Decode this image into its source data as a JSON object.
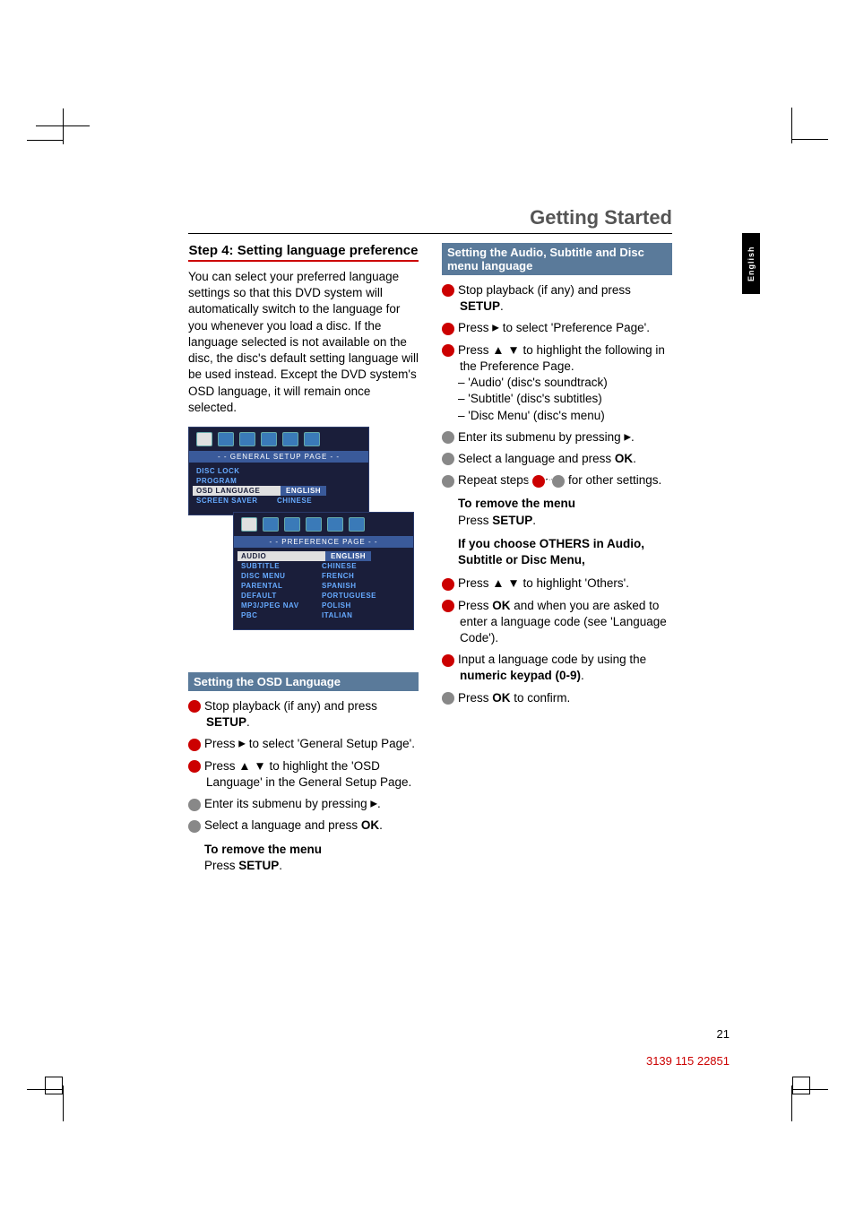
{
  "page_title": "Getting Started",
  "language_tab": "English",
  "page_number": "21",
  "doc_number": "3139 115 22851",
  "left": {
    "step_title": "Step 4: Setting language preference",
    "intro": "You can select your preferred language settings so that this DVD system will automatically switch to the language for you whenever you load a disc.  If the language selected is not available on the disc, the disc's default setting language will be used instead.  Except the DVD system's OSD language, it will remain once selected.",
    "osd1_banner": "- -  GENERAL SETUP PAGE  - -",
    "osd1_items": {
      "r1": "DISC LOCK",
      "r2": "PROGRAM",
      "r3l": "OSD LANGUAGE",
      "r3r": "ENGLISH",
      "r4l": "SCREEN SAVER",
      "r4r": "CHINESE"
    },
    "osd2_banner": "- -  PREFERENCE PAGE  - -",
    "osd2_items": {
      "r1l": "AUDIO",
      "r1r": "ENGLISH",
      "r2l": "SUBTITLE",
      "r2r": "CHINESE",
      "r3l": "DISC MENU",
      "r3r": "FRENCH",
      "r4l": "PARENTAL",
      "r4r": "SPANISH",
      "r5l": "DEFAULT",
      "r5r": "PORTUGUESE",
      "r6l": "MP3/JPEG NAV",
      "r6r": "POLISH",
      "r7l": "PBC",
      "r7r": "ITALIAN"
    },
    "subhead": "Setting the OSD Language",
    "steps": {
      "s1a": "Stop playback (if any) and press ",
      "s1b": "SETUP",
      "s1c": ".",
      "s2a": "Press ",
      "s2b": " to select 'General Setup Page'.",
      "s3": "Press ▲ ▼ to highlight the 'OSD Language' in the General Setup Page.",
      "s4a": "Enter its submenu by pressing ",
      "s4b": ".",
      "s5a": "Select a language and press ",
      "s5b": "OK",
      "s5c": "."
    },
    "remove_title": "To remove the menu",
    "remove_a": "Press ",
    "remove_b": "SETUP",
    "remove_c": "."
  },
  "right": {
    "subhead": "Setting the Audio, Subtitle and Disc menu language",
    "steps1": {
      "s1a": "Stop playback (if any) and press ",
      "s1b": "SETUP",
      "s1c": ".",
      "s2a": "Press ",
      "s2b": " to select 'Preference Page'.",
      "s3_intro": "Press ▲ ▼ to highlight the following in the Preference Page.",
      "s3_a": "–  'Audio' (disc's soundtrack)",
      "s3_b": "–  'Subtitle' (disc's subtitles)",
      "s3_c": "–  'Disc Menu' (disc's menu)",
      "s4a": "Enter its submenu by pressing ",
      "s4b": ".",
      "s5a": "Select a language and press ",
      "s5b": "OK",
      "s5c": ".",
      "s6a": "Repeat steps ",
      "s6b": "~",
      "s6c": " for other settings."
    },
    "remove_title": "To remove the menu",
    "remove_a": "Press ",
    "remove_b": "SETUP",
    "remove_c": ".",
    "others_title": "If you choose OTHERS in Audio, Subtitle or Disc Menu,",
    "steps2": {
      "s1": "Press ▲ ▼ to highlight 'Others'.",
      "s2a": "Press ",
      "s2b": "OK",
      "s2c": " and when you are asked to enter a language code (see 'Language Code').",
      "s3a": "Input a language code by using the ",
      "s3b": "numeric keypad (0-9)",
      "s3c": ".",
      "s4a": "Press ",
      "s4b": "OK",
      "s4c": " to confirm."
    }
  }
}
